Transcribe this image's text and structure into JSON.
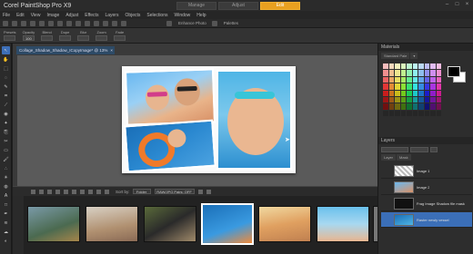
{
  "app": {
    "title": "Corel PaintShop Pro X9",
    "mode_tabs": [
      "Manage",
      "Adjust",
      "Edit"
    ],
    "window_controls": [
      "–",
      "□",
      "×"
    ]
  },
  "menu": [
    "File",
    "Edit",
    "View",
    "Image",
    "Adjust",
    "Effects",
    "Layers",
    "Objects",
    "Selections",
    "Window",
    "Help"
  ],
  "toolbar": {
    "labels": [
      "Enhance Photo",
      "Palettes"
    ]
  },
  "options": [
    {
      "label": "Presets",
      "value": ""
    },
    {
      "label": "Opacity",
      "value": "100"
    },
    {
      "label": "Blend",
      "value": ""
    },
    {
      "label": "Dupe",
      "value": ""
    },
    {
      "label": "Blur",
      "value": ""
    },
    {
      "label": "Zoom",
      "value": ""
    },
    {
      "label": "Fade",
      "value": ""
    }
  ],
  "document": {
    "tab_title": "Collage_Shadow_Shadow_ICopyImage* @ 13%",
    "close": "×"
  },
  "filmstrip": {
    "sort_label": "Sort by:",
    "sort_value": "Folder",
    "filter_value": "RAW/JPG Pairs: OFF"
  },
  "materials": {
    "title": "Materials",
    "tabs": [
      "Standard Pale",
      "▾"
    ]
  },
  "layers": {
    "title": "Layers",
    "tabs": [
      "Layer",
      "Mask"
    ],
    "items": [
      {
        "name": "Image 1",
        "selected": false
      },
      {
        "name": "Image 2",
        "selected": false
      },
      {
        "name": "Frag Image Shadow file mask",
        "selected": false
      },
      {
        "name": "Raster newly vessel",
        "selected": true
      }
    ]
  }
}
